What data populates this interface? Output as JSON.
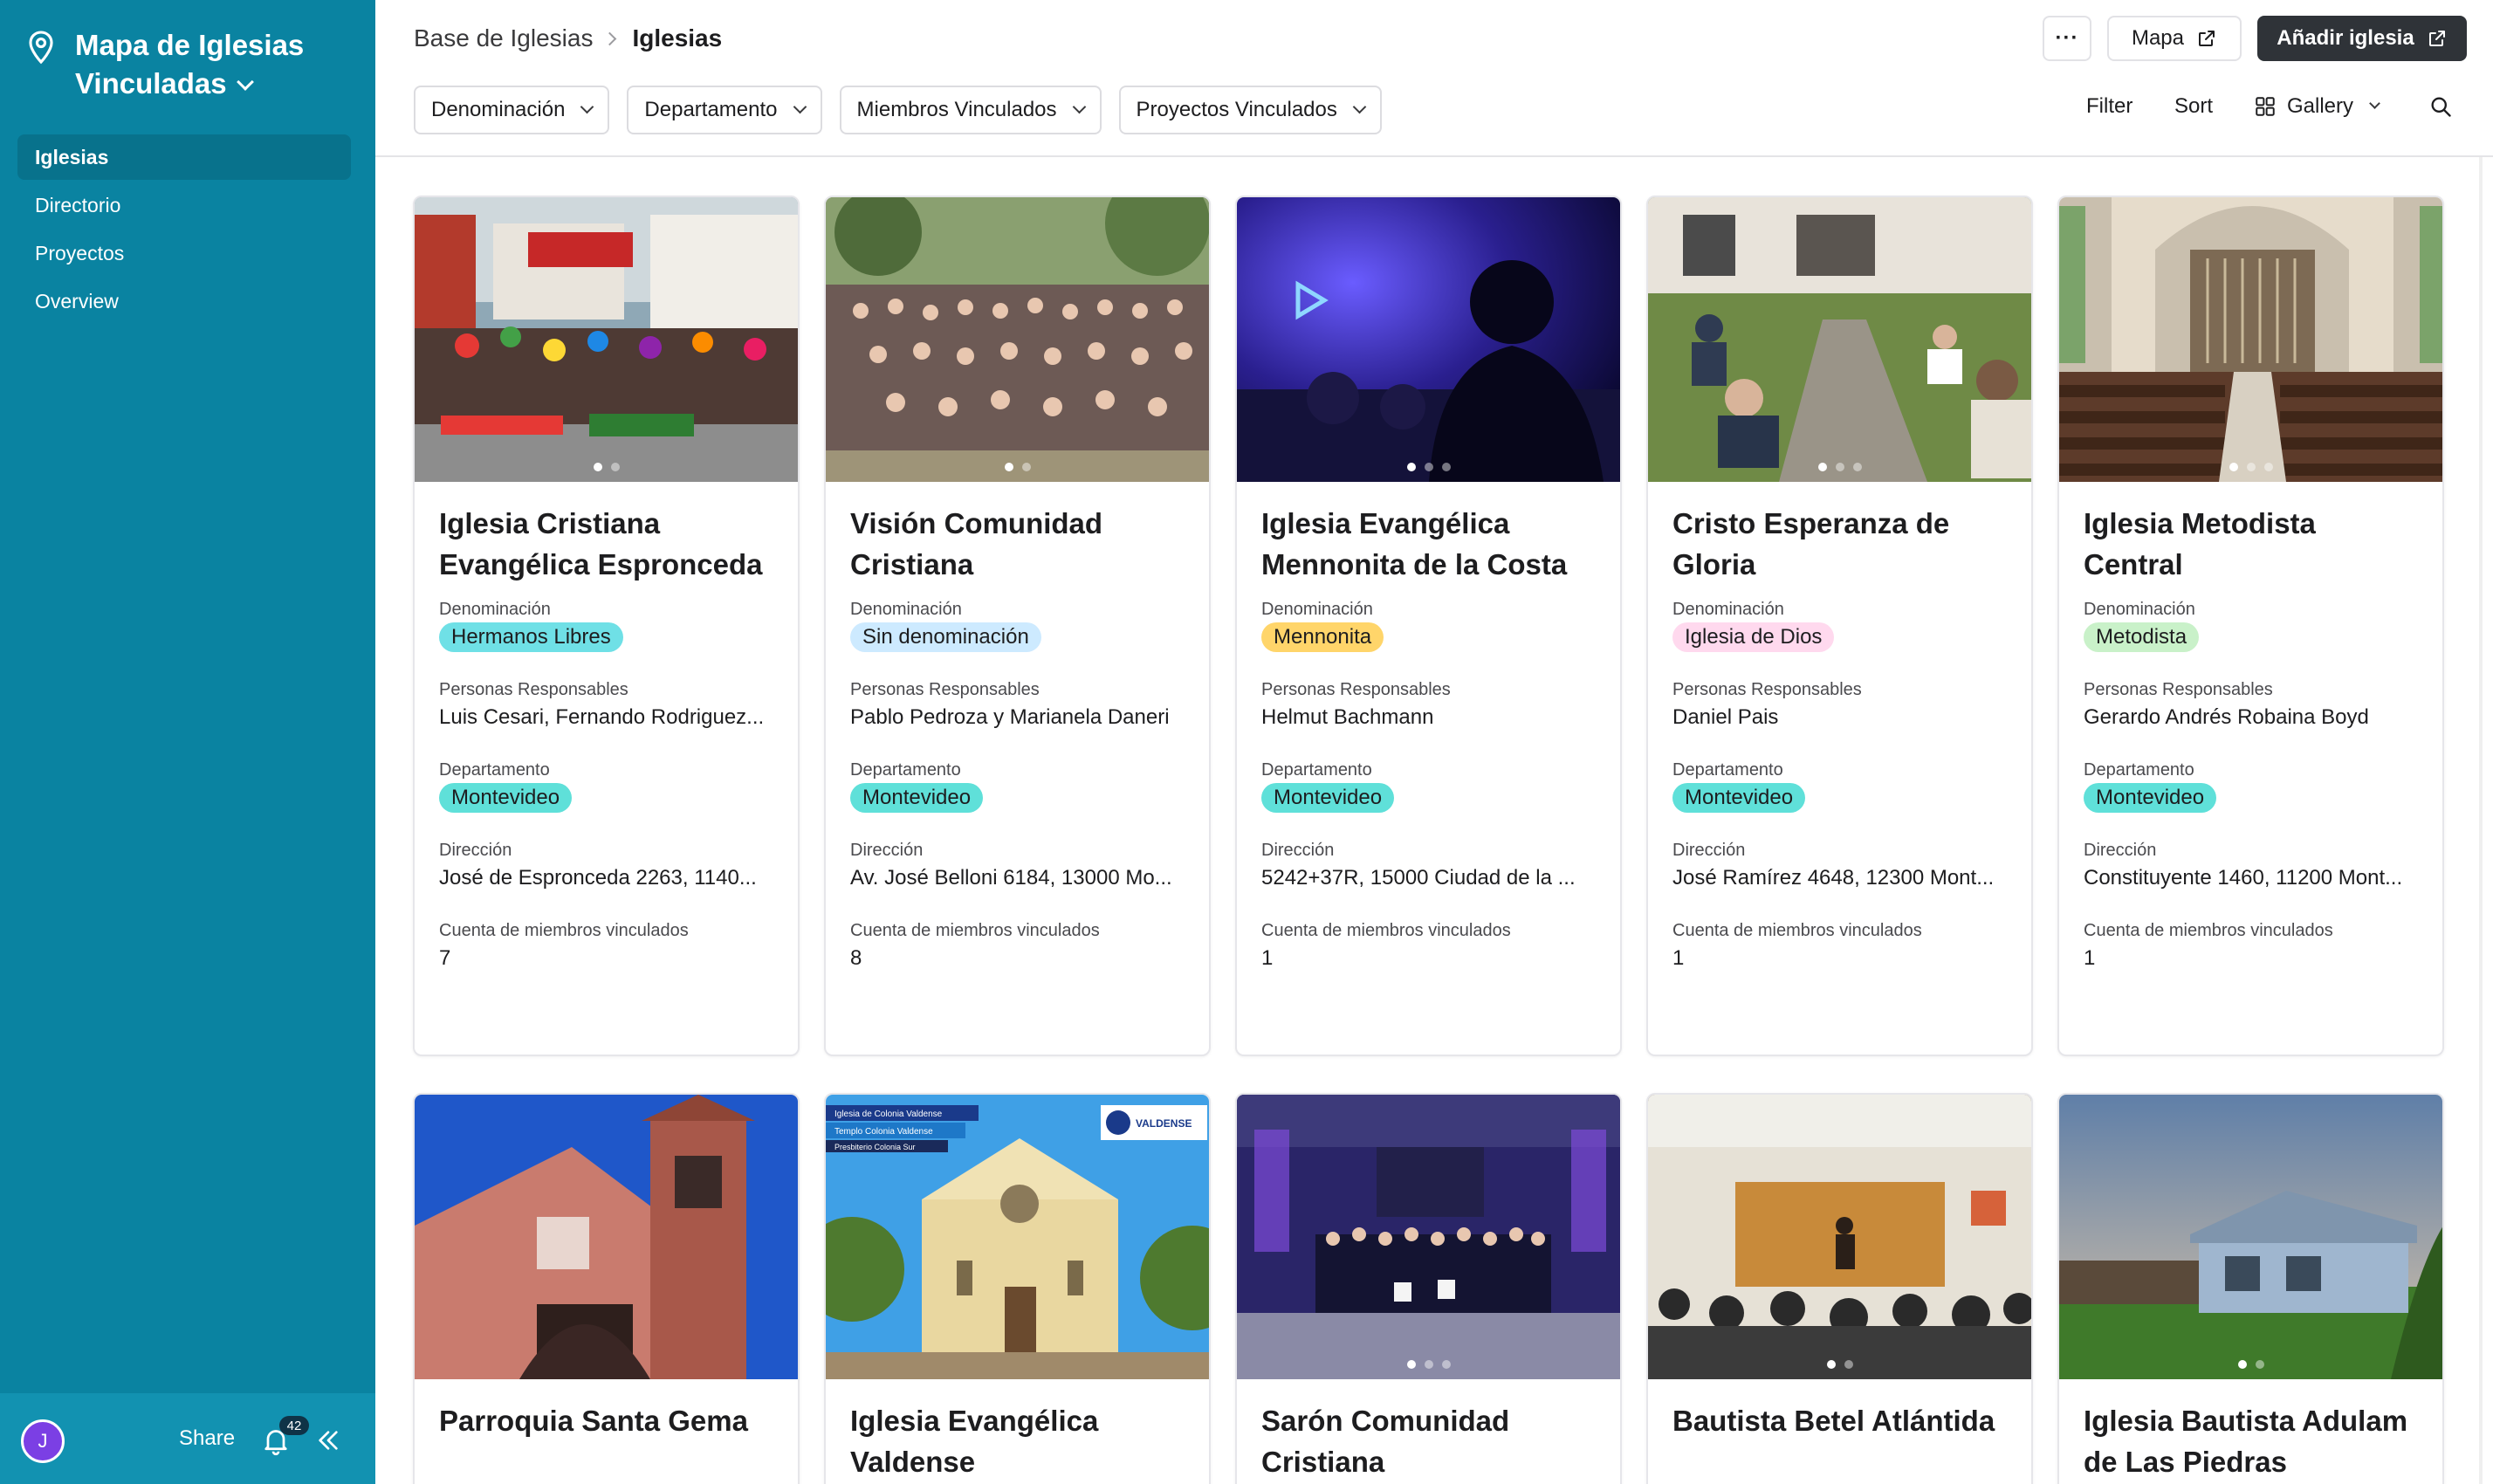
{
  "sidebar": {
    "title": "Mapa de Iglesias Vinculadas",
    "items": [
      {
        "label": "Iglesias",
        "active": true
      },
      {
        "label": "Directorio"
      },
      {
        "label": "Proyectos"
      },
      {
        "label": "Overview"
      }
    ],
    "footer": {
      "avatar_initial": "J",
      "share_label": "Share",
      "notification_count": "42"
    }
  },
  "header": {
    "breadcrumb_parent": "Base de Iglesias",
    "breadcrumb_current": "Iglesias",
    "more_label": "···",
    "map_label": "Mapa",
    "add_label": "Añadir iglesia"
  },
  "filters": [
    "Denominación",
    "Departamento",
    "Miembros Vinculados",
    "Proyectos Vinculados"
  ],
  "toolbar": {
    "filter_label": "Filter",
    "sort_label": "Sort",
    "view_label": "Gallery"
  },
  "field_labels": {
    "denominacion": "Denominación",
    "personas": "Personas Responsables",
    "departamento": "Departamento",
    "direccion": "Dirección",
    "cuenta": "Cuenta de miembros vinculados"
  },
  "colors": {
    "sidebar": "#0a83a1",
    "tag_hermanos": "#6fe0e6",
    "tag_sin": "#cdeaff",
    "tag_mennonita": "#ffd56a",
    "tag_iglesia_dios": "#ffd9ee",
    "tag_metodista": "#c9f1c9",
    "tag_montevideo": "#5fe0d9"
  },
  "cards": [
    {
      "name": "Iglesia Cristiana Evangélica Espronceda",
      "denominacion": "Hermanos Libres",
      "den_color": "#6fe0e6",
      "personas": "Luis Cesari, Fernando Rodriguez...",
      "departamento": "Montevideo",
      "direccion": "José de Espronceda 2263, 1140...",
      "cuenta": "7",
      "image": "community-celebration-photo"
    },
    {
      "name": "Visión Comunidad Cristiana",
      "denominacion": "Sin denominación",
      "den_color": "#cdeaff",
      "personas": "Pablo Pedroza y Marianela Daneri",
      "departamento": "Montevideo",
      "direccion": "Av. José Belloni 6184, 13000 Mo...",
      "cuenta": "8",
      "image": "large-group-outdoor-photo"
    },
    {
      "name": "Iglesia Evangélica Mennonita de la Costa",
      "denominacion": "Mennonita",
      "den_color": "#ffd56a",
      "personas": "Helmut Bachmann",
      "departamento": "Montevideo",
      "direccion": "5242+37R, 15000 Ciudad de la ...",
      "cuenta": "1",
      "image": "worship-concert-photo"
    },
    {
      "name": "Cristo Esperanza de Gloria",
      "denominacion": "Iglesia de Dios",
      "den_color": "#ffd9ee",
      "personas": "Daniel Pais",
      "departamento": "Montevideo",
      "direccion": "José Ramírez 4648, 12300 Mont...",
      "cuenta": "1",
      "image": "garden-meeting-photo"
    },
    {
      "name": "Iglesia Metodista Central",
      "denominacion": "Metodista",
      "den_color": "#c9f1c9",
      "personas": "Gerardo Andrés Robaina Boyd",
      "departamento": "Montevideo",
      "direccion": "Constituyente 1460, 11200 Mont...",
      "cuenta": "1",
      "image": "church-interior-photo"
    },
    {
      "name": "Parroquia Santa Gema",
      "image": "brick-church-tower-photo"
    },
    {
      "name": "Iglesia Evangélica Valdense",
      "image": "valdense-church-facade-photo",
      "image_caption_lines": [
        "Iglesia de Colonia Valdense",
        "Templo Colonia Valdense",
        "Presbiterio Colonia Sur"
      ],
      "image_logo_text": "VALDENSE"
    },
    {
      "name": "Sarón Comunidad Cristiana",
      "image": "group-on-stage-photo"
    },
    {
      "name": "Bautista Betel Atlántida",
      "image": "congregation-meeting-photo"
    },
    {
      "name": "Iglesia Bautista Adulam de Las Piedras",
      "image": "wooden-house-church-photo"
    }
  ]
}
